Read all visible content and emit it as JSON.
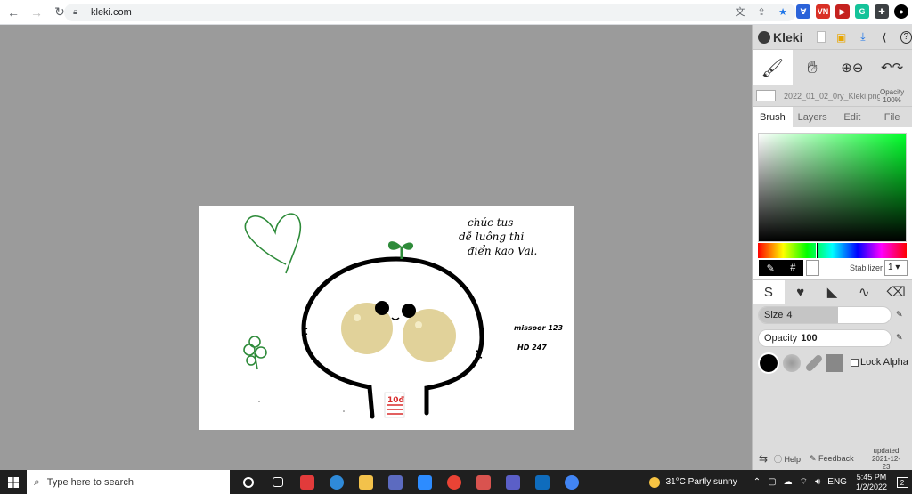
{
  "browser": {
    "url": "kleki.com",
    "extensions": [
      {
        "name": "translate",
        "color": "#5f6368",
        "glyph": "文"
      },
      {
        "name": "share",
        "color": "#5f6368",
        "glyph": "⇪"
      },
      {
        "name": "bookmark",
        "color": "#1a73e8",
        "glyph": "★"
      }
    ],
    "ext_toolbar": [
      {
        "name": "ext-blue",
        "color": "#2b63d9",
        "glyph": "Ɐ"
      },
      {
        "name": "ext-vn",
        "color": "#d93025",
        "glyph": "VN"
      },
      {
        "name": "ext-red",
        "color": "#c5221f",
        "glyph": "▶"
      },
      {
        "name": "ext-grammarly",
        "color": "#15c39a",
        "glyph": "G"
      },
      {
        "name": "ext-puzzle",
        "color": "#3c4043",
        "glyph": "✚"
      },
      {
        "name": "profile",
        "color": "#000000",
        "glyph": "●"
      },
      {
        "name": "menu",
        "color": "#5f6368",
        "glyph": "⋮"
      }
    ]
  },
  "kleki": {
    "logo": "Kleki",
    "file": {
      "name": "2022_01_02_0ry_Kleki.png",
      "opacity_label": "Opacity",
      "opacity_value": "100%"
    },
    "tabs": [
      "Brush",
      "Layers",
      "Edit",
      "File"
    ],
    "active_tab": "Brush",
    "color": {
      "hex_symbol": "#",
      "hue_fraction": 0.39
    },
    "stabilizer": {
      "label": "Stabilizer",
      "value": "1"
    },
    "size": {
      "label": "Size",
      "value": "4",
      "fraction": 0.6
    },
    "opacity": {
      "label": "Opacity",
      "value": "100",
      "fraction": 1.0
    },
    "lock_alpha": "Lock Alpha",
    "bottom": {
      "help": "Help",
      "feedback": "Feedback",
      "updated_label": "updated",
      "updated_date": "2021-12-23"
    }
  },
  "drawing": {
    "note_top_1": "chúc tus",
    "note_top_2": "dễ luông thi",
    "note_top_3": "điển kao Val.",
    "note_side_1": "missoor 123",
    "note_side_2": "HD 247",
    "badge": "10đ",
    "colors": {
      "stroke": "#000000",
      "green": "#2e8b3a",
      "cheek": "#e1d29a",
      "red": "#d92c2c"
    }
  },
  "taskbar": {
    "search_placeholder": "Type here to search",
    "weather": "31°C  Partly sunny",
    "lang": "ENG",
    "time": "5:45 PM",
    "date": "1/2/2022",
    "notifications": "2",
    "apps": [
      {
        "name": "cortana",
        "color": "#ffffff"
      },
      {
        "name": "task-view",
        "color": "#ffffff"
      },
      {
        "name": "app-red",
        "color": "#e23b3b"
      },
      {
        "name": "edge",
        "color": "#2f8ad8"
      },
      {
        "name": "file-explorer",
        "color": "#f3c24b"
      },
      {
        "name": "store",
        "color": "#5c6bc0"
      },
      {
        "name": "zoom",
        "color": "#2d8cff"
      },
      {
        "name": "chrome",
        "color": "#ea4335"
      },
      {
        "name": "paint",
        "color": "#d9534f"
      },
      {
        "name": "teams",
        "color": "#5b5fc7"
      },
      {
        "name": "mail",
        "color": "#0f6cbd"
      },
      {
        "name": "chrome-profile",
        "color": "#4285f4"
      }
    ]
  }
}
